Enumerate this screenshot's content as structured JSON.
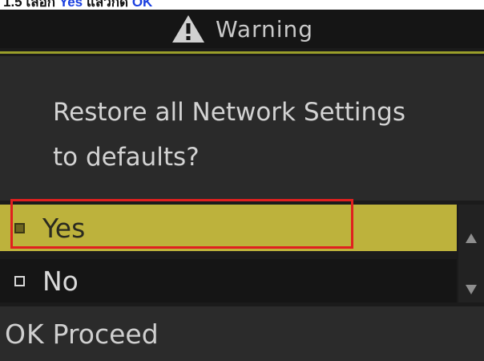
{
  "caption": {
    "text_prefix": "1.5 เลือก ",
    "highlight_1": "Yes",
    "text_mid": " แล้วกด ",
    "highlight_2": "OK"
  },
  "header": {
    "icon": "warning-icon",
    "title": "Warning"
  },
  "message": "Restore all Network Settings\nto defaults?",
  "options": [
    {
      "label": "Yes",
      "selected": true
    },
    {
      "label": "No",
      "selected": false
    }
  ],
  "footer": {
    "key": "OK",
    "action": "Proceed"
  },
  "colors": {
    "selected_bg": "#bdb23c",
    "highlight_frame": "#e0201f",
    "caption_highlight": "#1a3fe0"
  }
}
